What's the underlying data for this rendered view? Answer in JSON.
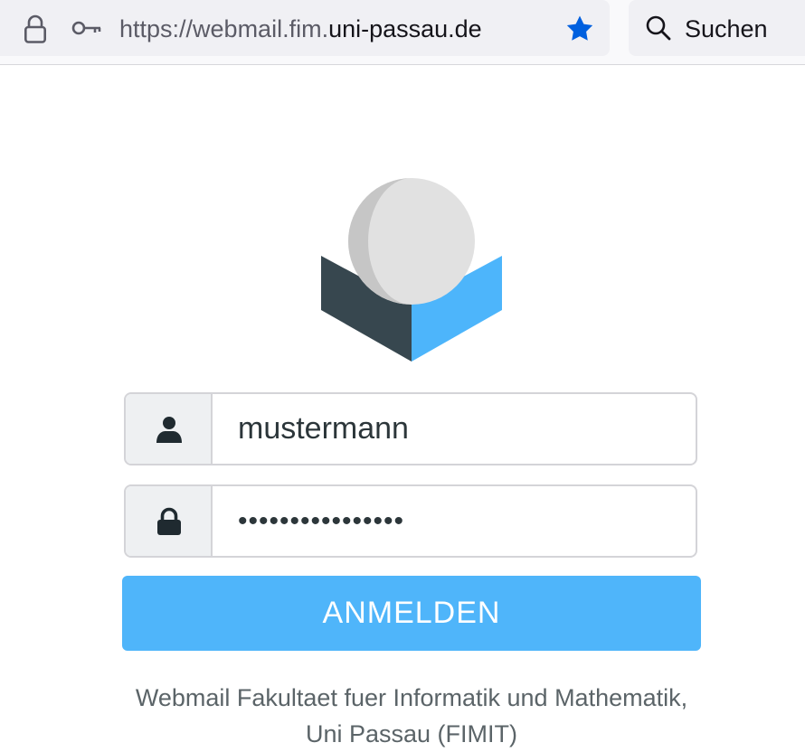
{
  "browser": {
    "url_prefix": "https://webmail.fim.",
    "url_host": "uni-passau.de",
    "search_label": "Suchen",
    "star_color": "#0060df",
    "icons": [
      "lock-icon",
      "key-icon",
      "star-icon",
      "search-icon"
    ]
  },
  "login": {
    "username_value": "mustermann",
    "password_value": "••••••••••••••••",
    "submit_label": "ANMELDEN",
    "footer_line1": "Webmail Fakultaet fuer Informatik und Mathematik,",
    "footer_line2": "Uni Passau (FIMIT)",
    "accent_color": "#4fb5fa",
    "icons": [
      "user-icon",
      "padlock-icon",
      "roundcube-logo"
    ]
  }
}
